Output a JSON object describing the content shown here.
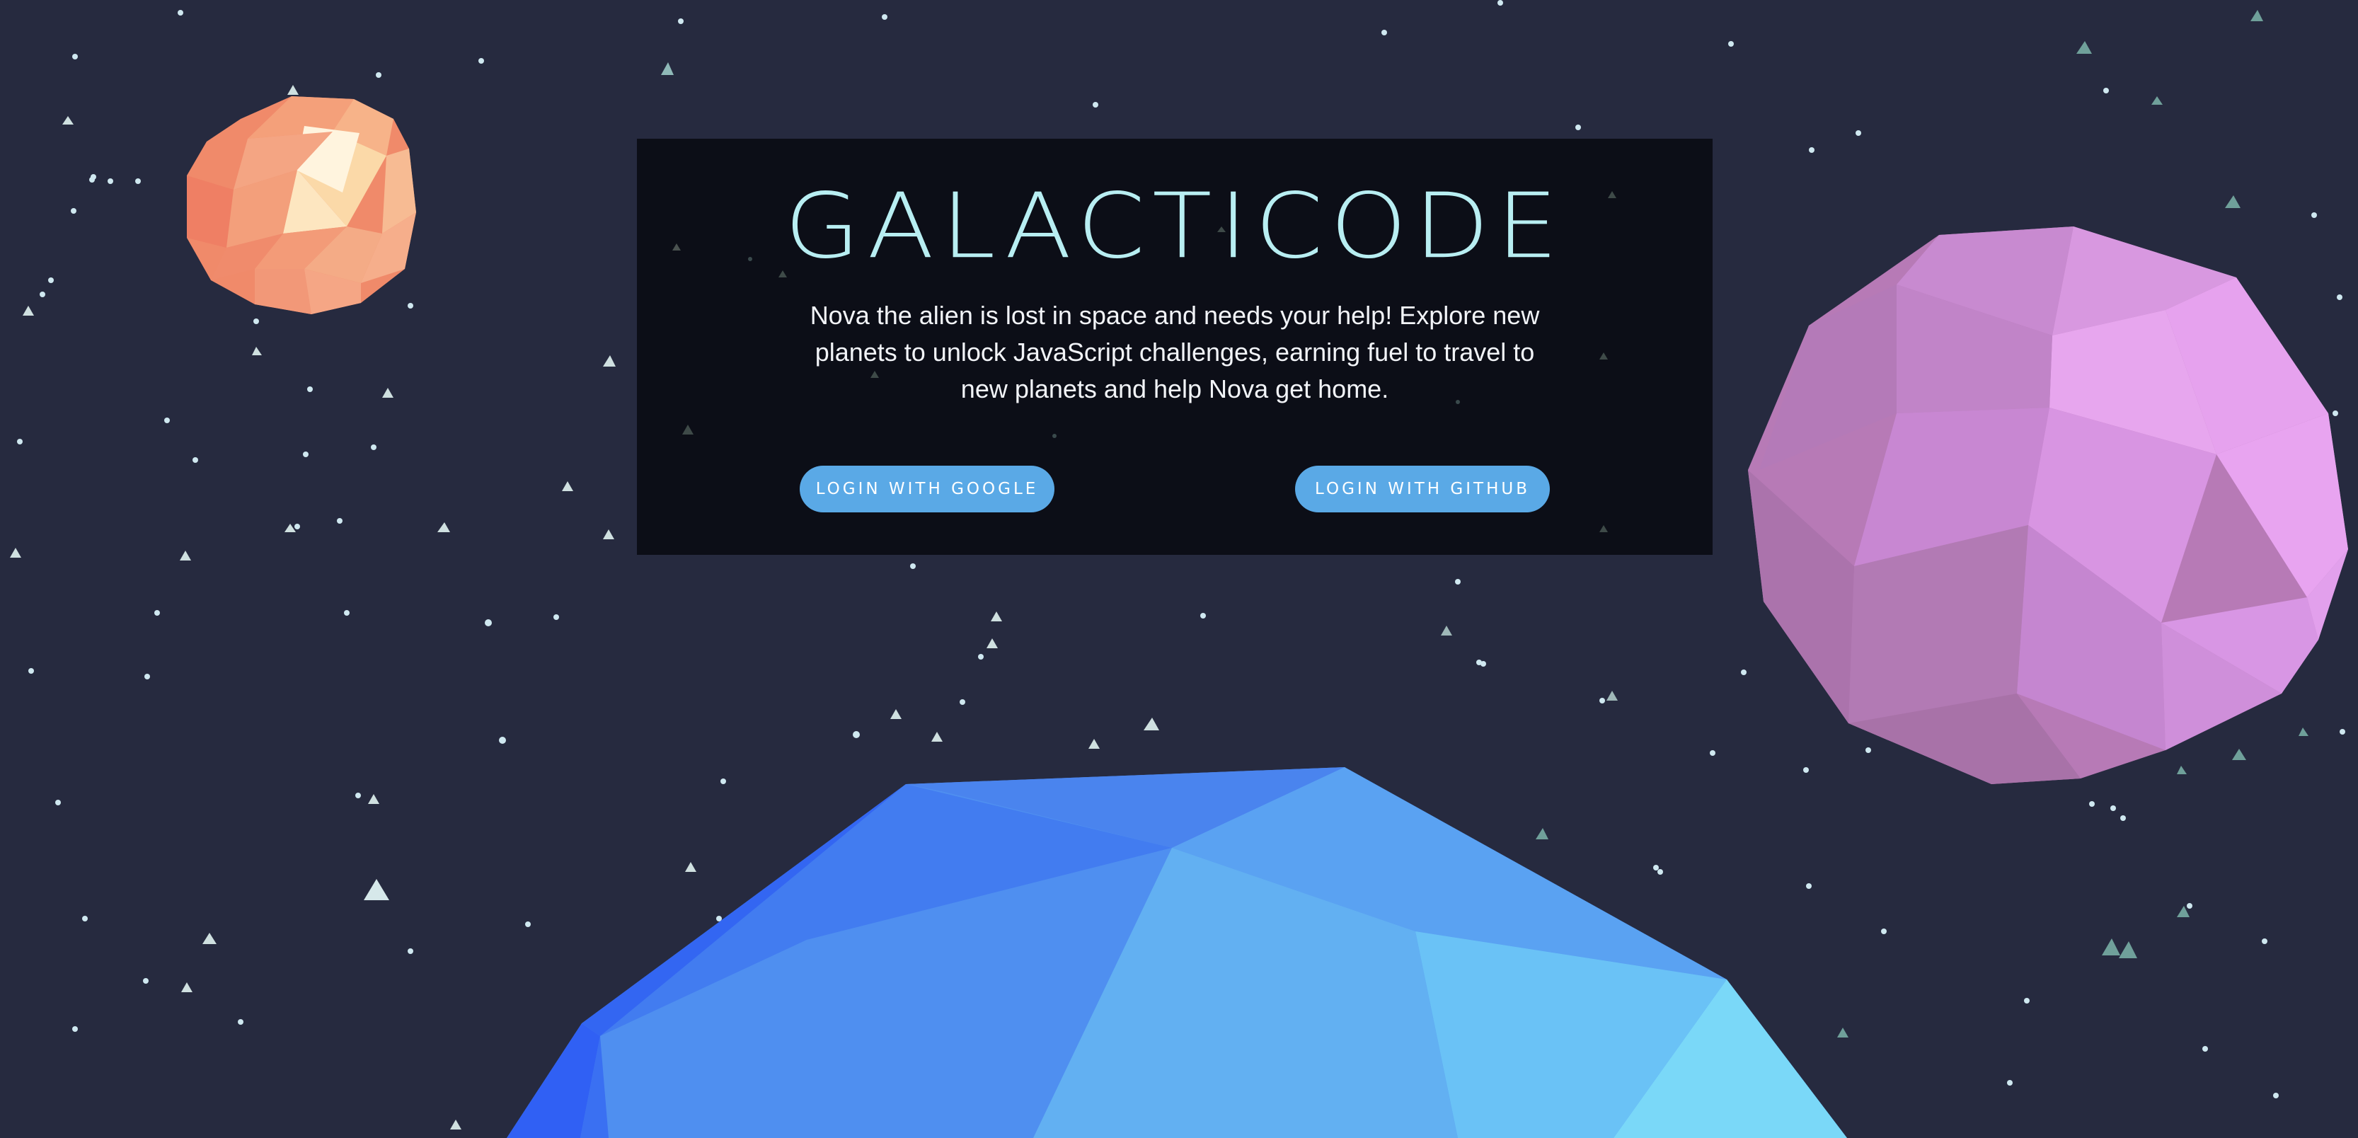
{
  "app": {
    "title": "GALACTICODE",
    "description": "Nova the alien is lost in space and needs your help! Explore new planets to unlock JavaScript challenges, earning fuel to travel to new planets and help Nova get home."
  },
  "actions": {
    "google_login_label": "LOGIN WITH GOOGLE",
    "github_login_label": "LOGIN WITH GITHUB"
  },
  "colors": {
    "background": "#262a3f",
    "panel": "#0c0e17",
    "title": "#b8eef2",
    "button": "#5aa9e6",
    "planet_orange": "#f2876a",
    "planet_pink": "#d98ee8",
    "planet_blue": "#4f8ff0"
  }
}
